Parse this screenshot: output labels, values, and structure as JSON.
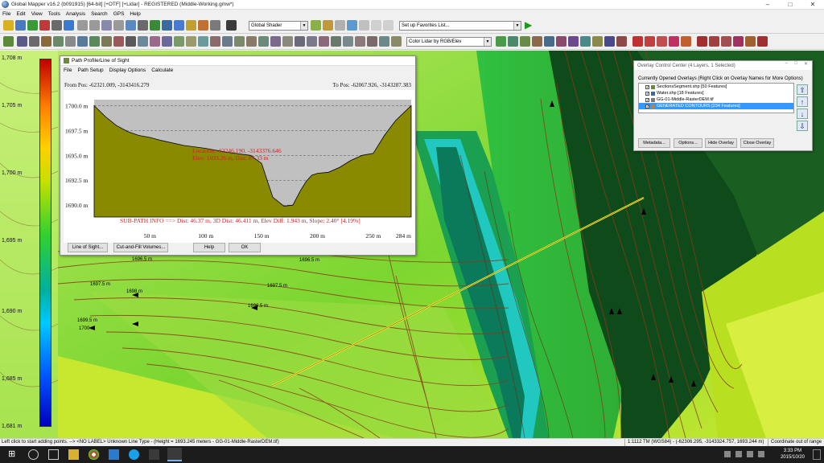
{
  "window": {
    "title": "Global Mapper v16.2 (b091915) [64-bit] [+OTF] [+Lidar] - REGISTERED (Middle-Working.gmw*)"
  },
  "menu": [
    "File",
    "Edit",
    "View",
    "Tools",
    "Analysis",
    "Search",
    "GPS",
    "Help"
  ],
  "toolbar": {
    "shader": "Global Shader",
    "favorites": "Set up Favorites List...",
    "lidar_color": "Color Lidar by RGB/Elev"
  },
  "legend": {
    "labels": [
      "1,708 m",
      "1,705 m",
      "1,700 m",
      "1,695 m",
      "1,690 m",
      "1,685 m",
      "1,681 m"
    ]
  },
  "path_profile": {
    "title": "Path Profile/Line of Sight",
    "menu": [
      "File",
      "Path Setup",
      "Display Options",
      "Calculate"
    ],
    "from_pos": "From Pos: -62321.009, -3143416.279",
    "to_pos": "To Pos: -62067.926, -3143287.383",
    "location": "Location: -62246.190, -3143376.646",
    "elev_text": "Elev: 1693.26 m, Dist: 87.33 m",
    "sub_path_info": "SUB-PATH INFO ==> Dist: 46.37 m, 3D Dist: 46.411 m, Elev Diff: 1.943 m, Slope: 2.40° [4.19%]",
    "buttons": {
      "los": "Line of Sight...",
      "cutfill": "Cut-and-Fill Volumes...",
      "help": "Help",
      "ok": "OK"
    },
    "chart_data": {
      "type": "area",
      "y_tick_labels": [
        "1700.0 m",
        "1697.5 m",
        "1695.0 m",
        "1692.5 m",
        "1690.0 m"
      ],
      "x_tick_labels": [
        "50 m",
        "100 m",
        "150 m",
        "200 m",
        "250 m",
        "284 m"
      ],
      "ylim": [
        1688.8,
        1700.6
      ],
      "xlim": [
        0,
        284
      ],
      "x": [
        0,
        10,
        20,
        30,
        40,
        50,
        60,
        80,
        100,
        120,
        140,
        150,
        155,
        160,
        170,
        178,
        185,
        190,
        195,
        200,
        210,
        220,
        230,
        240,
        250,
        260,
        270,
        284
      ],
      "y": [
        1700.0,
        1698.9,
        1698.0,
        1697.4,
        1697.0,
        1696.8,
        1696.5,
        1696.0,
        1695.7,
        1695.3,
        1695.0,
        1694.2,
        1692.5,
        1690.8,
        1689.9,
        1690.0,
        1691.5,
        1692.4,
        1693.0,
        1693.2,
        1693.3,
        1693.8,
        1694.5,
        1695.0,
        1695.2,
        1697.0,
        1698.5,
        1700.0
      ],
      "grid": true
    }
  },
  "overlay_center": {
    "title": "Overlay Control Center (4 Layers, 1 Selected)",
    "header": "Currently Opened Overlays (Right Click on Overlay Names for More Options)",
    "layers": [
      {
        "name": "SectionsSegment.shp [50 Features]",
        "color": "#6a8a3a"
      },
      {
        "name": "Water.shp [18 Features]",
        "color": "#3a6aa0"
      },
      {
        "name": "GG-01-Middle-RasterDEM.tif",
        "color": "#7a7a7a"
      },
      {
        "name": "GENERATED CONTOURS [234 Features]",
        "color": "#c08030"
      }
    ],
    "buttons": {
      "metadata": "Metadata...",
      "options": "Options...",
      "hide": "Hide Overlay",
      "close": "Close Overlay"
    }
  },
  "map_labels": [
    "1696.5 m",
    "1697.5 m",
    "1698 m",
    "1699.5 m",
    "1700 m",
    "1696.5 m",
    "1696.5 m",
    "1697.5 m"
  ],
  "statusbar": {
    "hint": "Left click to start adding points. --> <NO LABEL> Unknown Line Type - (Height = 1693.245 meters - GG-01-Middle-RasterDEM.tif)",
    "coords": "1:1112   TM (WGS84) - (-62306.295, -3143324.757, 1693.244 m)",
    "status": "Coordinate out of range"
  },
  "taskbar": {
    "time": "3:33 PM",
    "date": "2015/10/20"
  }
}
